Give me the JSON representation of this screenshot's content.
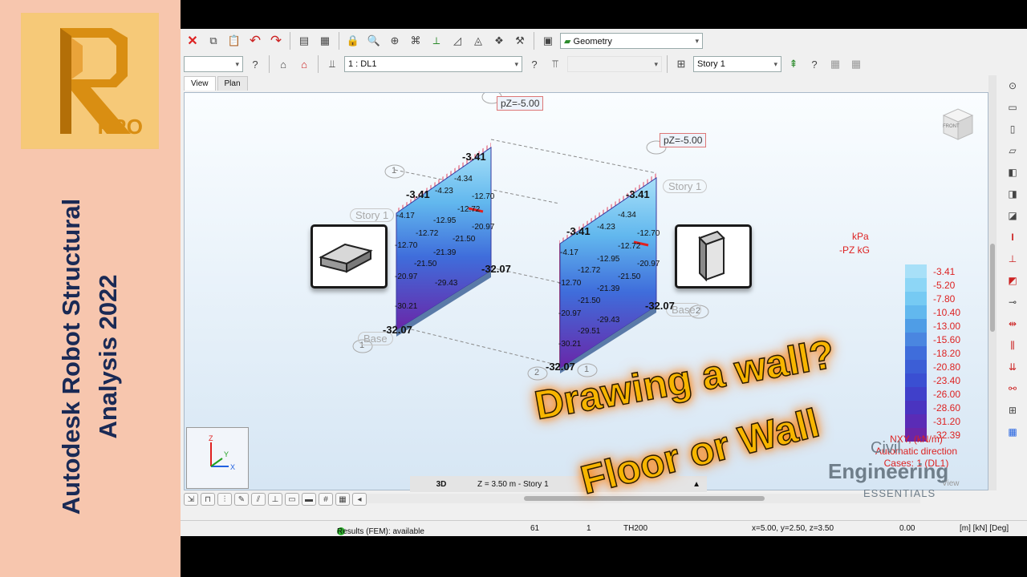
{
  "side_panel": {
    "logo_letter": "R",
    "logo_badge": "PRO",
    "title_line1": "Autodesk Robot Structural",
    "title_line2": "Analysis 2022"
  },
  "toolbar": {
    "view_combo": "Geometry",
    "case_combo": "1 : DL1",
    "story_combo": "Story 1"
  },
  "tabs": [
    {
      "label": "View"
    },
    {
      "label": "Plan"
    }
  ],
  "viewport": {
    "load_label_1": "pZ=-5.00",
    "load_label_2": "pZ=-5.00",
    "story_label_1": "Story 1",
    "story_label_2": "Story 1",
    "base_label_1": "Base",
    "base_label_2": "Base",
    "node_numbers": [
      "1",
      "1",
      "2",
      "2",
      "1"
    ],
    "cube_face": "FRONT",
    "wall1_values": [
      "-3.41",
      "-3.41",
      "-4.34",
      "-4.23",
      "-4.17",
      "-12.70",
      "-12.72",
      "-12.95",
      "-12.72",
      "-12.70",
      "-20.97",
      "-21.50",
      "-21.39",
      "-21.50",
      "-20.97",
      "-29.43",
      "-30.21",
      "-32.07",
      "-32.07"
    ],
    "wall2_values": [
      "-3.41",
      "-3.41",
      "-4.34",
      "-4.23",
      "-4.17",
      "-12.72",
      "-12.70",
      "-12.95",
      "-12.72",
      "-12.70",
      "-20.97",
      "-21.50",
      "-21.39",
      "-21.50",
      "-20.97",
      "-29.51",
      "-29.43",
      "-30.21",
      "-32.07",
      "-32.07"
    ]
  },
  "legend": {
    "unit_label": "kPa",
    "unit2_label": "-PZ  kG",
    "values": [
      "-3.41",
      "-5.20",
      "-7.80",
      "-10.40",
      "-13.00",
      "-15.60",
      "-18.20",
      "-20.80",
      "-23.40",
      "-26.00",
      "-28.60",
      "-31.20",
      "-32.39"
    ],
    "colors": [
      "#a8e0f8",
      "#8dd6f6",
      "#76caf3",
      "#62b8ee",
      "#4f9de6",
      "#4a86e0",
      "#3f6ddb",
      "#3c5ed6",
      "#3a4fd2",
      "#4040ca",
      "#4a34c0",
      "#5a2cb6",
      "#6a26a8"
    ],
    "caption_line1": "NXY, (kN/m)",
    "caption_line2": "Automatic direction",
    "caption_line3": "Cases: 1 (DL1)"
  },
  "view_bar": {
    "mode": "3D",
    "position": "Z = 3.50 m - Story 1",
    "corner": "View"
  },
  "status": {
    "results": "Results (FEM): available",
    "count": "61",
    "field1": "1",
    "section": "TH200",
    "coords": "x=5.00, y=2.50, z=3.50",
    "value": "0.00",
    "units": "[m] [kN] [Deg]"
  },
  "overlay": {
    "line1": "Drawing a wall?",
    "line2": "Floor or Wall"
  },
  "watermark": {
    "civil": "Civil",
    "engineering": "Engineering",
    "essentials": "ESSENTIALS"
  }
}
